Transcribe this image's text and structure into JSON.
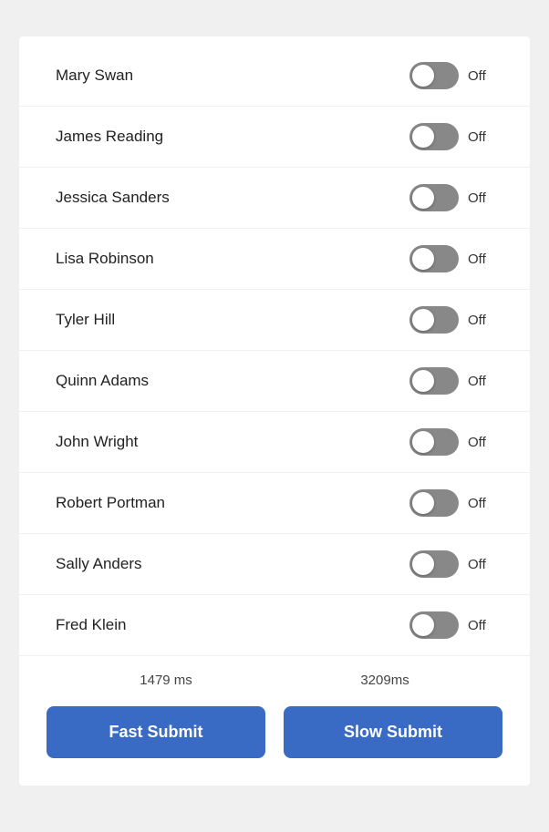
{
  "people": [
    {
      "name": "Mary Swan",
      "state": "off"
    },
    {
      "name": "James Reading",
      "state": "off"
    },
    {
      "name": "Jessica Sanders",
      "state": "off"
    },
    {
      "name": "Lisa Robinson",
      "state": "off"
    },
    {
      "name": "Tyler Hill",
      "state": "off"
    },
    {
      "name": "Quinn Adams",
      "state": "off"
    },
    {
      "name": "John Wright",
      "state": "off"
    },
    {
      "name": "Robert Portman",
      "state": "off"
    },
    {
      "name": "Sally Anders",
      "state": "off"
    },
    {
      "name": "Fred Klein",
      "state": "off"
    }
  ],
  "timings": {
    "fast_ms": "1479 ms",
    "slow_ms": "3209ms"
  },
  "buttons": {
    "fast_label": "Fast Submit",
    "slow_label": "Slow Submit"
  },
  "toggle_off_label": "Off"
}
